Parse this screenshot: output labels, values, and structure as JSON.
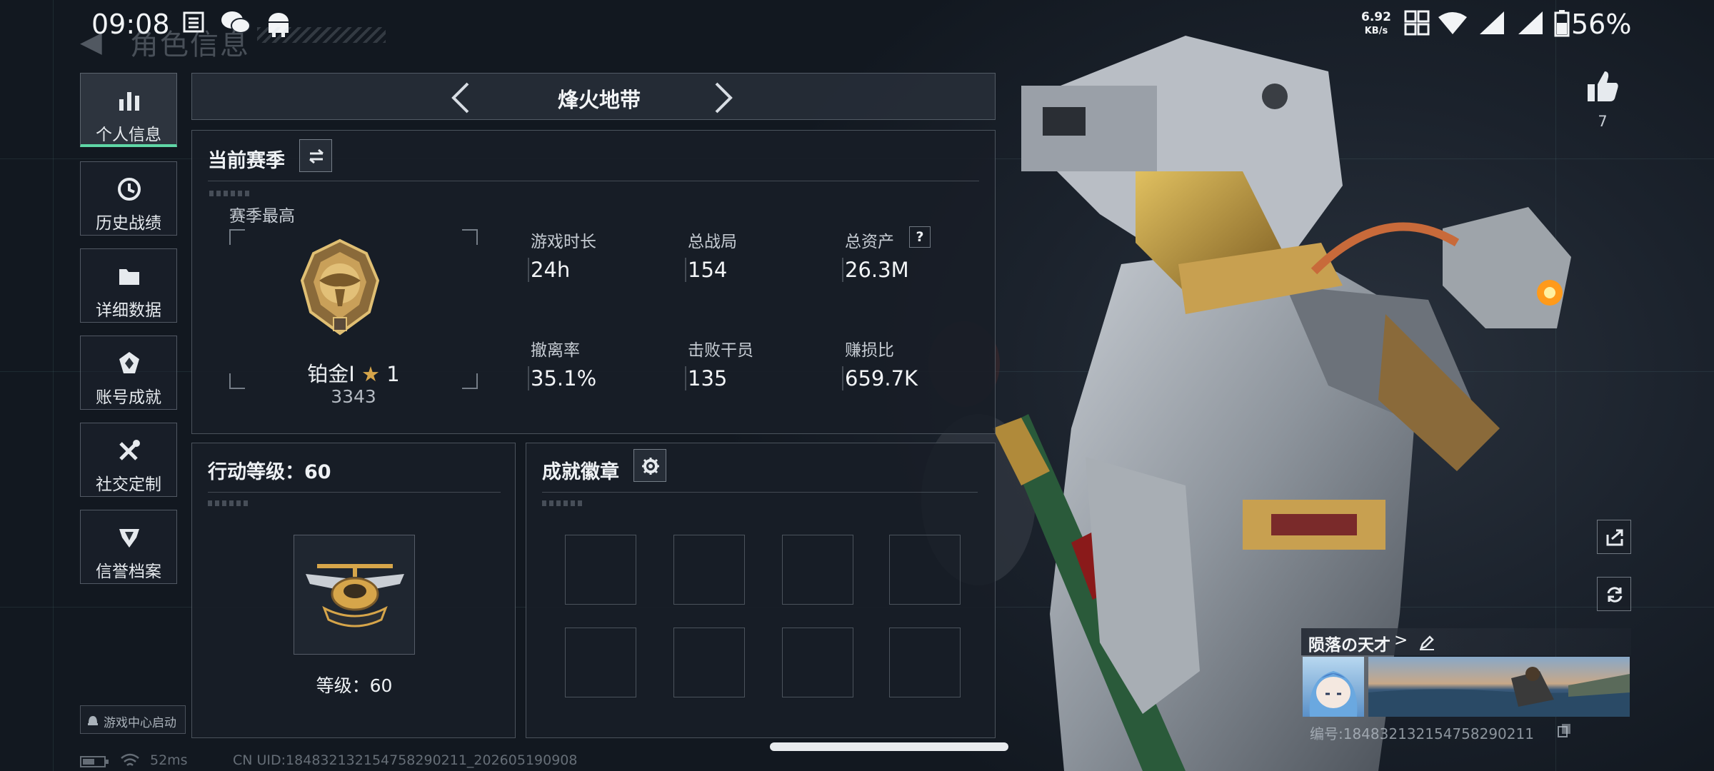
{
  "status_bar": {
    "time": "09:08",
    "net_speed_value": "6.92",
    "net_speed_unit": "KB/s",
    "battery": "56%",
    "icons": [
      "calendar-icon",
      "wechat-icon",
      "android-icon",
      "hd-icon",
      "wifi-icon",
      "signal-icon",
      "signal-icon",
      "battery-icon"
    ]
  },
  "header": {
    "ghost_title": "角色信息"
  },
  "sidebar": {
    "items": [
      {
        "label": "个人信息",
        "icon": "bar-chart-icon",
        "active": true
      },
      {
        "label": "历史战绩",
        "icon": "history-icon",
        "active": false
      },
      {
        "label": "详细数据",
        "icon": "folder-icon",
        "active": false
      },
      {
        "label": "账号成就",
        "icon": "achievement-icon",
        "active": false
      },
      {
        "label": "社交定制",
        "icon": "tools-icon",
        "active": false
      },
      {
        "label": "信誉档案",
        "icon": "shield-icon",
        "active": false
      }
    ],
    "game_center_label": "游戏中心启动"
  },
  "mode_selector": {
    "title": "烽火地带"
  },
  "season": {
    "title": "当前赛季",
    "best_label": "赛季最高",
    "rank_name": "铂金I",
    "rank_stars": "1",
    "rank_score": "3343",
    "stats": [
      {
        "label": "游戏时长",
        "value": "24h"
      },
      {
        "label": "总战局",
        "value": "154"
      },
      {
        "label": "总资产",
        "value": "26.3M",
        "has_help": true
      },
      {
        "label": "撤离率",
        "value": "35.1%"
      },
      {
        "label": "击败干员",
        "value": "135"
      },
      {
        "label": "赚损比",
        "value": "659.7K"
      }
    ],
    "help_symbol": "?"
  },
  "action_level": {
    "title": "行动等级：60",
    "level_text": "等级：60"
  },
  "badges": {
    "title": "成就徽章",
    "slot_count": 8
  },
  "right_panel": {
    "likes": "7",
    "player_name": "陨落の天才",
    "player_name_suffix": ">",
    "player_id": "编号:184832132154758290211"
  },
  "footer": {
    "ping": "52ms",
    "uid": "CN UID:184832132154758290211_202605190908"
  },
  "colors": {
    "accent": "#5fd6a6",
    "gold": "#d6a54a",
    "background": "#151b24"
  }
}
